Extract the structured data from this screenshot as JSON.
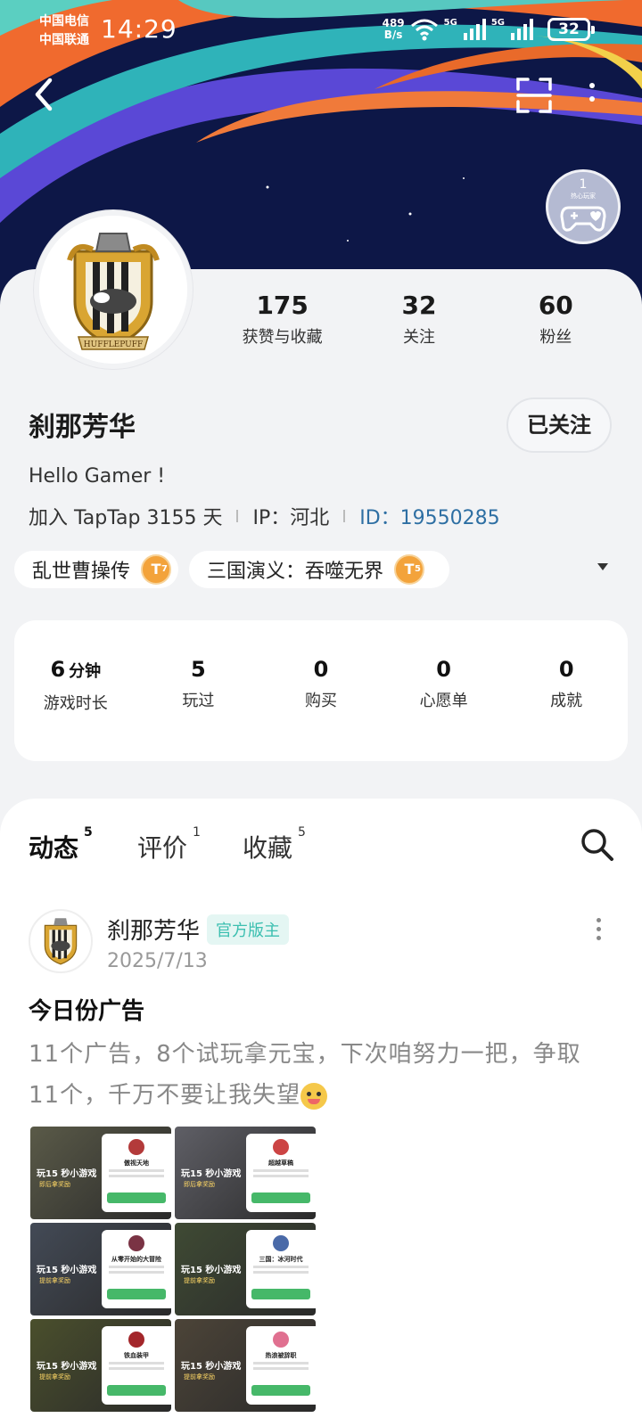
{
  "status_bar": {
    "carrier1": "中国电信",
    "carrier2": "中国联通",
    "time": "14:29",
    "net_speed_value": "489",
    "net_speed_unit": "B/s",
    "signal1": "5G",
    "signal2": "5G",
    "battery": "32"
  },
  "header": {
    "badge_count": "1",
    "badge_label": "热心玩家"
  },
  "profile": {
    "stats": [
      {
        "value": "175",
        "label": "获赞与收藏"
      },
      {
        "value": "32",
        "label": "关注"
      },
      {
        "value": "60",
        "label": "粉丝"
      }
    ],
    "name": "刹那芳华",
    "follow_label": "已关注",
    "bio": "Hello Gamer !",
    "joined": "加入 TapTap 3155 天",
    "ip": "IP：河北",
    "user_id": "ID：19550285",
    "game_tags": [
      {
        "name": "乱世曹操传",
        "level": "7"
      },
      {
        "name": "三国演义：吞噬无界",
        "level": "5"
      }
    ]
  },
  "game_stats": [
    {
      "value": "6",
      "unit": "分钟",
      "label": "游戏时长"
    },
    {
      "value": "5",
      "label": "玩过"
    },
    {
      "value": "0",
      "label": "购买"
    },
    {
      "value": "0",
      "label": "心愿单"
    },
    {
      "value": "0",
      "label": "成就"
    }
  ],
  "tabs": [
    {
      "label": "动态",
      "count": "5",
      "active": true
    },
    {
      "label": "评价",
      "count": "1"
    },
    {
      "label": "收藏",
      "count": "5"
    }
  ],
  "post": {
    "author": "刹那芳华",
    "author_tag": "官方版主",
    "date": "2025/7/13",
    "title": "今日份广告",
    "body": "11个广告，8个试玩拿元宝，下次咱努力一把，争取11个，千万不要让我失望",
    "images": [
      {
        "cta": "玩15 秒小游戏",
        "sub": "即后拿奖励",
        "title": "傲视天地",
        "avatar_color": "#b33a3a",
        "bg": "#5a5a48"
      },
      {
        "cta": "玩15 秒小游戏",
        "sub": "即后拿奖励",
        "title": "超越草稿",
        "avatar_color": "#c44",
        "bg": "#5f5f66"
      },
      {
        "cta": "玩15 秒小游戏",
        "sub": "提前拿奖励",
        "title": "从零开始的大冒险",
        "avatar_color": "#7a3344",
        "bg": "#434a56"
      },
      {
        "cta": "玩15 秒小游戏",
        "sub": "提前拿奖励",
        "title": "三国：冰河时代",
        "avatar_color": "#4a6aa8",
        "bg": "#3f4a34"
      },
      {
        "cta": "玩15 秒小游戏",
        "sub": "提前拿奖励",
        "title": "铁血装甲",
        "avatar_color": "#a3262a",
        "bg": "#4a4f2c"
      },
      {
        "cta": "玩15 秒小游戏",
        "sub": "提前拿奖励",
        "title": "热浪被辞职",
        "avatar_color": "#e07090",
        "bg": "#4c4438"
      }
    ]
  }
}
